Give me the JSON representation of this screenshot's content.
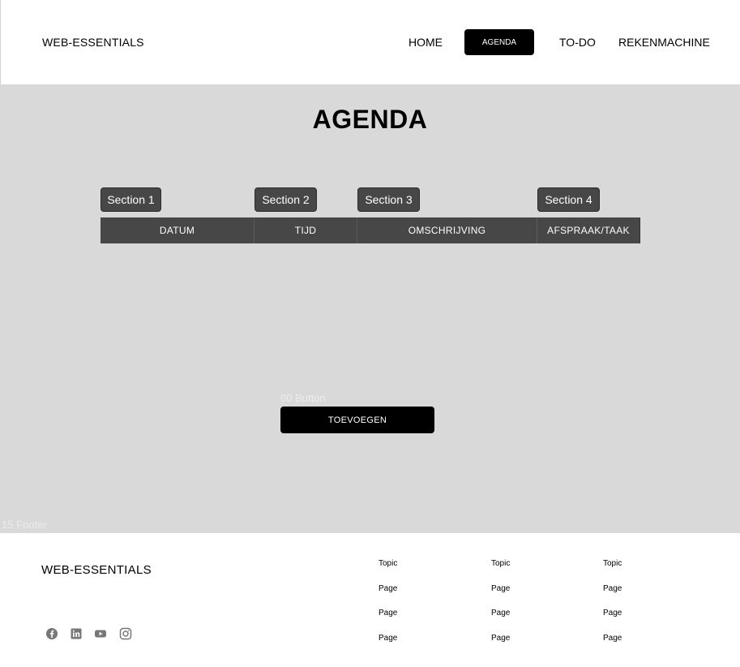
{
  "header": {
    "logo": "WEB-ESSENTIALS",
    "nav": {
      "home": "HOME",
      "agenda": "AGENDA",
      "todo": "TO-DO",
      "calculator": "REKENMACHINE"
    }
  },
  "main": {
    "title": "AGENDA",
    "sections": [
      "Section 1",
      "Section 2",
      "Section 3",
      "Section 4"
    ],
    "columns": [
      "DATUM",
      "TIJD",
      "OMSCHRIJVING",
      "AFSPRAAK/TAAK"
    ],
    "button_frame_label": "00 Button",
    "add_button": "TOEVOEGEN",
    "footer_frame_label": "15 Footer"
  },
  "footer": {
    "logo": "WEB-ESSENTIALS",
    "social_icons": [
      "facebook-icon",
      "linkedin-icon",
      "youtube-icon",
      "instagram-icon"
    ],
    "columns": [
      {
        "topic": "Topic",
        "pages": [
          "Page",
          "Page",
          "Page"
        ]
      },
      {
        "topic": "Topic",
        "pages": [
          "Page",
          "Page",
          "Page"
        ]
      },
      {
        "topic": "Topic",
        "pages": [
          "Page",
          "Page",
          "Page"
        ]
      }
    ]
  }
}
